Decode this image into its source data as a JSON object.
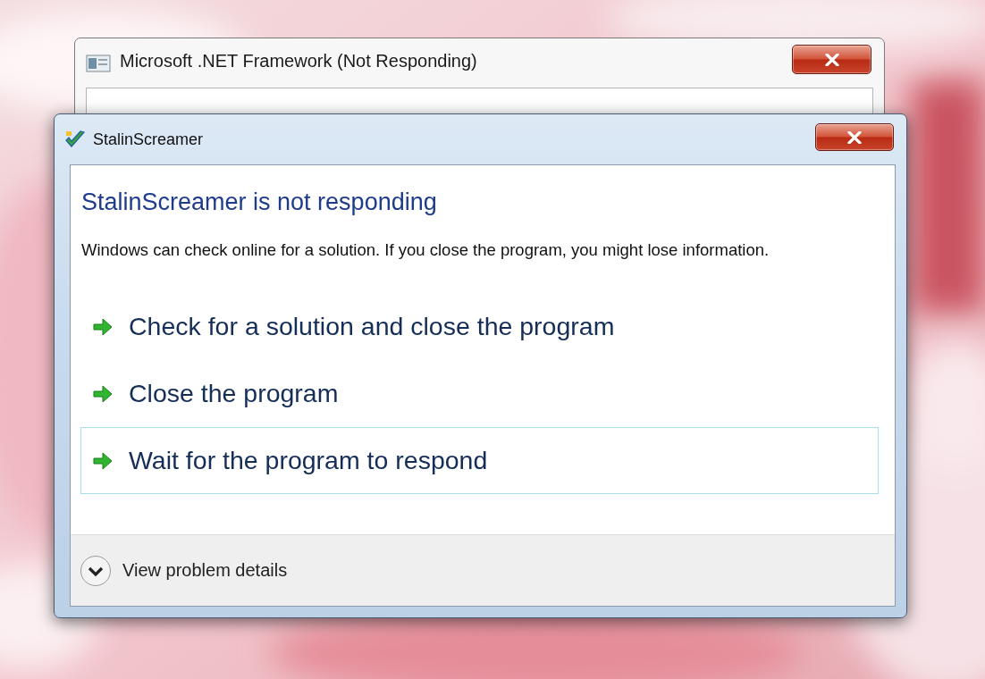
{
  "back_window": {
    "title": "Microsoft .NET Framework (Not Responding)"
  },
  "dialog": {
    "title": "StalinScreamer",
    "heading": "StalinScreamer is not responding",
    "message": "Windows can check online for a solution. If you close the program, you might lose information.",
    "options": [
      {
        "label": "Check for a solution and close the program",
        "focused": false
      },
      {
        "label": "Close the program",
        "focused": false
      },
      {
        "label": "Wait for the program to respond",
        "focused": true
      }
    ],
    "footer": {
      "label": "View problem details",
      "expanded": false
    }
  }
}
